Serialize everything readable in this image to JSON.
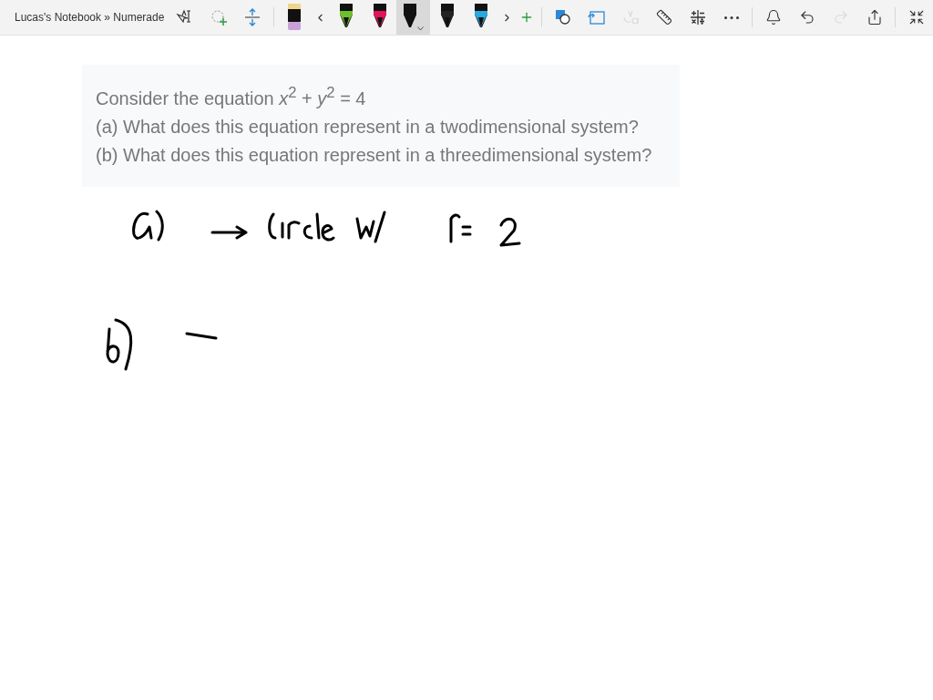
{
  "window": {
    "title": "Lucas's Notebook » Numerade"
  },
  "tools_left": [
    {
      "kind": "typeselect",
      "disabled": false
    },
    {
      "kind": "lasso",
      "disabled": false
    },
    {
      "kind": "space",
      "disabled": false
    },
    {
      "kind": "eraser",
      "disabled": false
    }
  ],
  "pens": [
    {
      "color": "#6cc12b",
      "selected": false
    },
    {
      "color": "#e3125a",
      "selected": false
    },
    {
      "color": "#111111",
      "selected": true
    },
    {
      "color": "#222222",
      "selected": false
    },
    {
      "color": "#27a9e1",
      "selected": false
    }
  ],
  "tools_right": [
    {
      "kind": "shapes",
      "disabled": false
    },
    {
      "kind": "inktoshape",
      "disabled": false
    },
    {
      "kind": "inktotext",
      "disabled": true
    },
    {
      "kind": "ruler",
      "disabled": false
    },
    {
      "kind": "math",
      "disabled": false
    },
    {
      "kind": "more",
      "disabled": false
    },
    {
      "kind": "bell",
      "disabled": false
    },
    {
      "kind": "undo",
      "disabled": false
    },
    {
      "kind": "redo",
      "disabled": true
    },
    {
      "kind": "share",
      "disabled": false
    },
    {
      "kind": "shrink",
      "disabled": false
    }
  ],
  "question": {
    "lines": [
      "Consider the equation *x*$^{2}$ + *y*$^{2}$ = 4",
      "(a) What does this equation represent in a twodimensional system?",
      "(b) What does this equation represent in a threedimensional system?"
    ]
  }
}
